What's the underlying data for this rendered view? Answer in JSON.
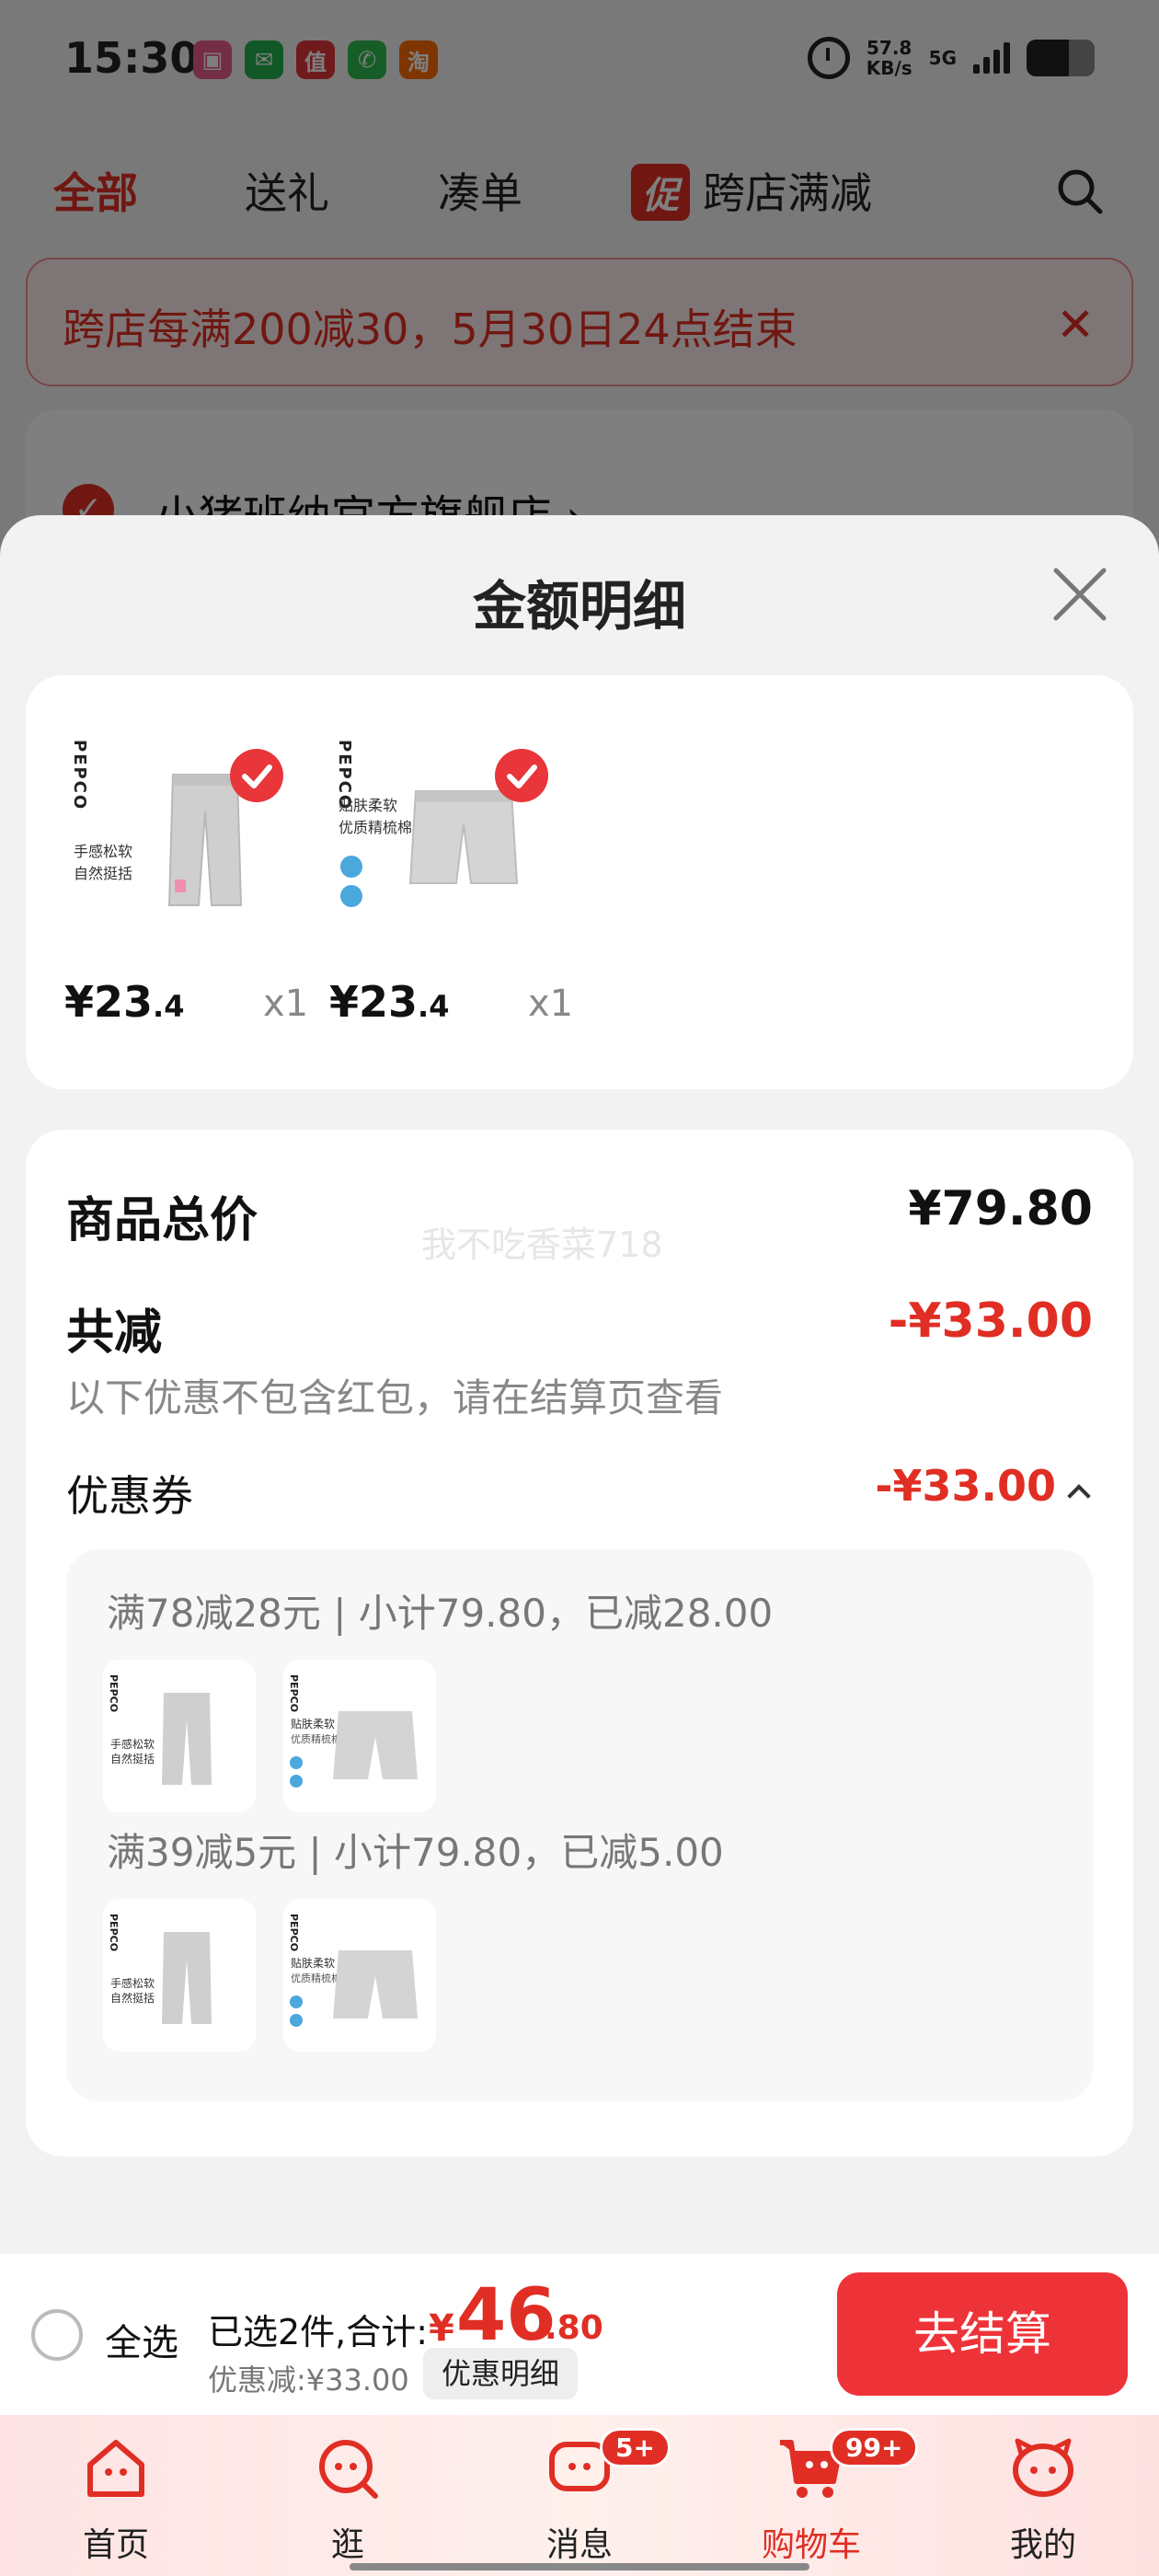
{
  "status_bar": {
    "time": "15:30",
    "net_speed_value": "57.8",
    "net_speed_unit": "KB/s",
    "network": "5G",
    "apps": [
      {
        "name": "game-app-icon",
        "glyph": "▣",
        "color": "#e85a8a"
      },
      {
        "name": "wechat-icon",
        "glyph": "✉",
        "color": "#22b14c"
      },
      {
        "name": "zhi-app-icon",
        "glyph": "值",
        "color": "#e0343c"
      },
      {
        "name": "phone-app-icon",
        "glyph": "✆",
        "color": "#2dbb4e"
      },
      {
        "name": "taobao-icon",
        "glyph": "淘",
        "color": "#ff6a00"
      }
    ]
  },
  "top_tabs": {
    "all": "全部",
    "gift": "送礼",
    "bundle": "凑单",
    "promo_badge": "促",
    "cross_store": "跨店满减"
  },
  "promo_banner": {
    "text": "跨店每满200减30，5月30日24点结束"
  },
  "store": {
    "name": "小猪班纳官方旗舰店 ›"
  },
  "sheet": {
    "title": "金额明细",
    "items": [
      {
        "brand": "PEPCO",
        "caption_1": "手感松软",
        "caption_2": "自然挺括",
        "price_main": "¥23",
        "price_dec": ".4",
        "qty": "x1"
      },
      {
        "brand": "PEPCO",
        "caption_1": "贴肤柔软",
        "caption_2": "优质精梳棉",
        "price_main": "¥23",
        "price_dec": ".4",
        "qty": "x1"
      }
    ],
    "summary": {
      "total_label": "商品总价",
      "total_value": "¥79.80",
      "watermark": "我不吃香菜718",
      "reduce_label": "共减",
      "reduce_value": "-¥33.00",
      "note": "以下优惠不包含红包，请在结算页查看",
      "coupon_label": "优惠券",
      "coupon_value": "-¥33.00",
      "coupons": [
        {
          "line": "满78减28元 | 小计79.80，已减28.00"
        },
        {
          "line": "满39减5元 | 小计79.80，已减5.00"
        }
      ]
    }
  },
  "action_bar": {
    "select_all": "全选",
    "selected_text": "已选2件,合计:",
    "total_currency": "¥",
    "total_int": "46",
    "total_dec": ".80",
    "discount_text": "优惠减:¥33.00",
    "detail_chip": "优惠明细",
    "checkout": "去结算"
  },
  "tab_bar": {
    "items": [
      {
        "label": "首页",
        "badge": ""
      },
      {
        "label": "逛",
        "badge": ""
      },
      {
        "label": "消息",
        "badge": "5+"
      },
      {
        "label": "购物车",
        "badge": "99+"
      },
      {
        "label": "我的",
        "badge": ""
      }
    ]
  },
  "colors": {
    "accent": "#e02e24",
    "checkout": "#ee3338"
  }
}
